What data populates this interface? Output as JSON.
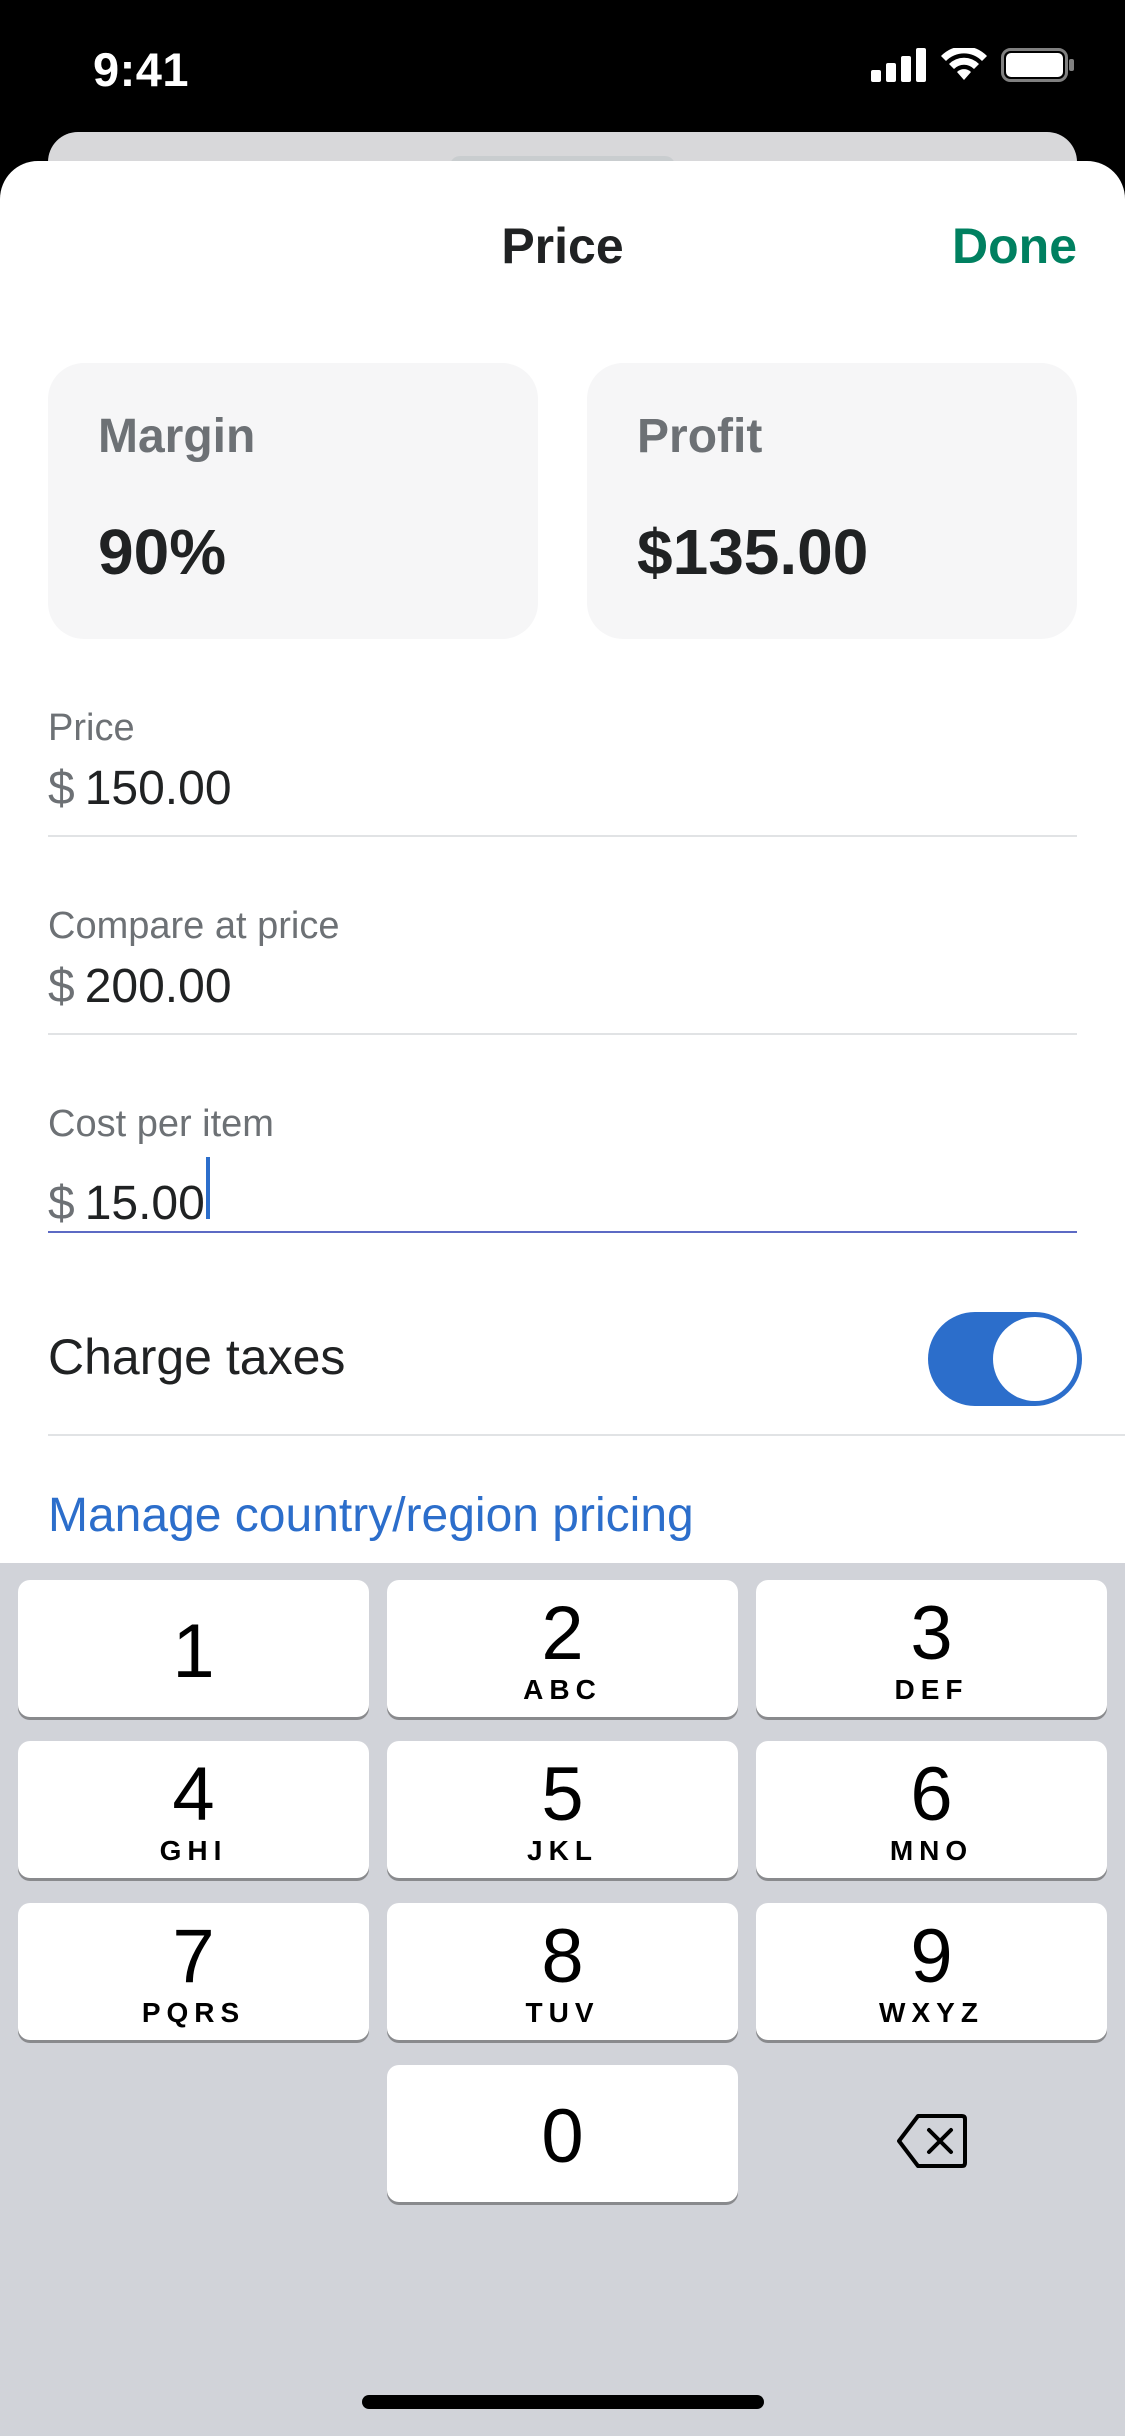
{
  "status_bar": {
    "time": "9:41"
  },
  "header": {
    "title": "Price",
    "done_label": "Done"
  },
  "stats": {
    "margin": {
      "label": "Margin",
      "value": "90%"
    },
    "profit": {
      "label": "Profit",
      "value": "$135.00"
    }
  },
  "fields": {
    "price": {
      "label": "Price",
      "currency": "$",
      "value": "150.00"
    },
    "compare_at_price": {
      "label": "Compare at price",
      "currency": "$",
      "value": "200.00"
    },
    "cost_per_item": {
      "label": "Cost per item",
      "currency": "$",
      "value": "15.00"
    }
  },
  "charge_taxes": {
    "label": "Charge taxes",
    "enabled": true
  },
  "region_link": {
    "label": "Manage country/region pricing"
  },
  "keyboard": {
    "keys": [
      {
        "digit": "1",
        "letters": ""
      },
      {
        "digit": "2",
        "letters": "ABC"
      },
      {
        "digit": "3",
        "letters": "DEF"
      },
      {
        "digit": "4",
        "letters": "GHI"
      },
      {
        "digit": "5",
        "letters": "JKL"
      },
      {
        "digit": "6",
        "letters": "MNO"
      },
      {
        "digit": "7",
        "letters": "PQRS"
      },
      {
        "digit": "8",
        "letters": "TUV"
      },
      {
        "digit": "9",
        "letters": "WXYZ"
      },
      {
        "digit": "0",
        "letters": ""
      }
    ],
    "delete_icon": "delete-backspace-icon"
  },
  "colors": {
    "accent_green": "#008060",
    "link_blue": "#2c6ecb",
    "toggle_on": "#2c6ecb",
    "keyboard_bg": "#d1d3d9"
  }
}
